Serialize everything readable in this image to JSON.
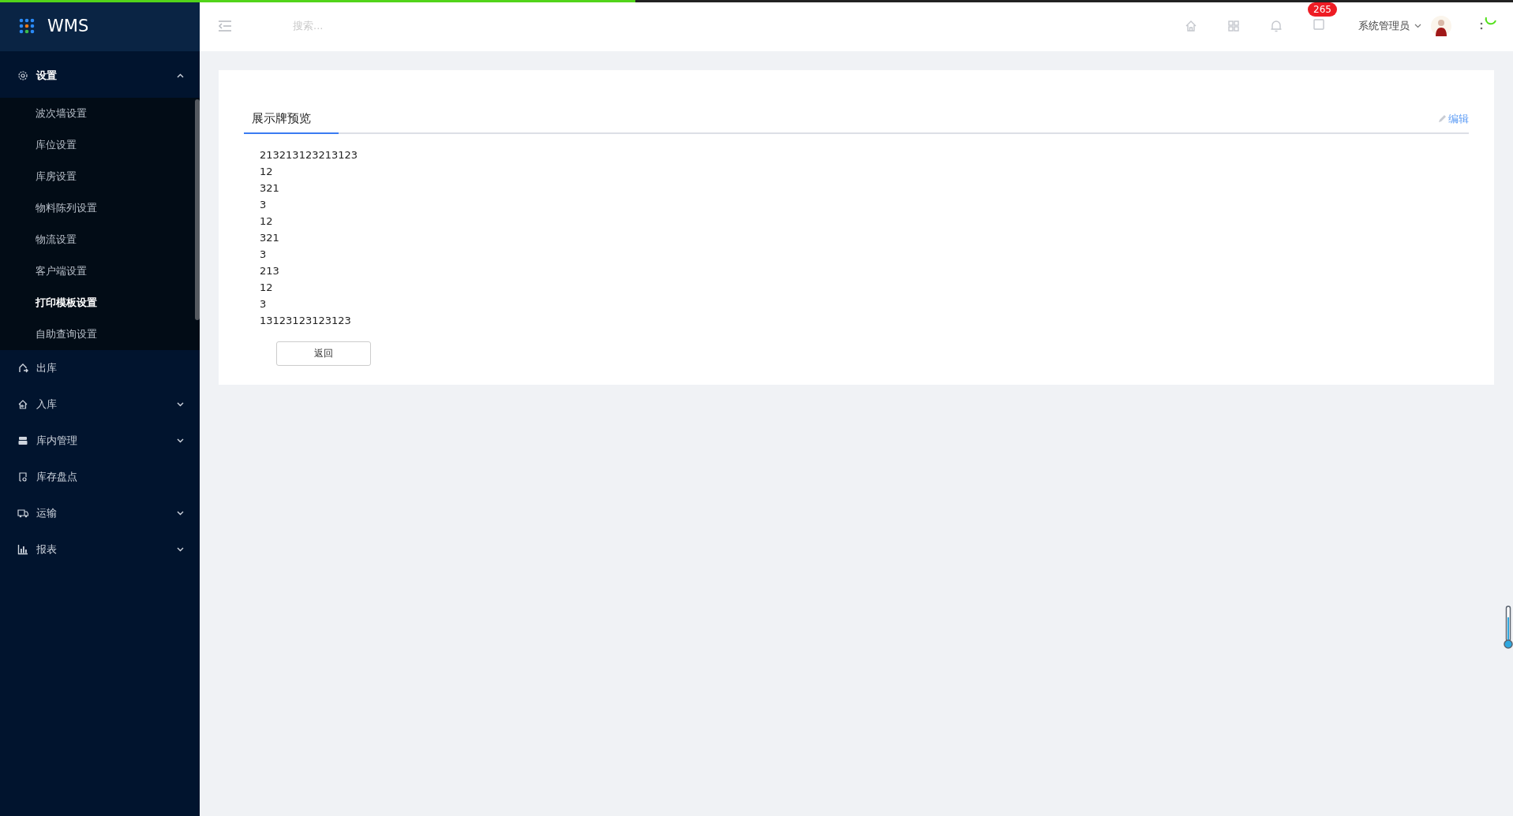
{
  "app": {
    "title": "WMS"
  },
  "progress": {
    "level": 0.42
  },
  "sidebar": {
    "items": [
      {
        "label": "设置",
        "expanded": true,
        "children": [
          {
            "label": "波次墙设置",
            "selected": false
          },
          {
            "label": "库位设置",
            "selected": false
          },
          {
            "label": "库房设置",
            "selected": false
          },
          {
            "label": "物料陈列设置",
            "selected": false
          },
          {
            "label": "物流设置",
            "selected": false
          },
          {
            "label": "客户端设置",
            "selected": false
          },
          {
            "label": "打印模板设置",
            "selected": true
          },
          {
            "label": "自助查询设置",
            "selected": false
          }
        ]
      },
      {
        "label": "出库"
      },
      {
        "label": "入库",
        "expanded": false
      },
      {
        "label": "库内管理",
        "expanded": false
      },
      {
        "label": "库存盘点"
      },
      {
        "label": "运输",
        "expanded": false
      },
      {
        "label": "报表",
        "expanded": false
      }
    ]
  },
  "header": {
    "search": {
      "placeholder": "搜索..."
    },
    "message_badge": "265",
    "user": "系统管理员"
  },
  "panel": {
    "tab": {
      "label": "展示牌预览",
      "selected": true
    },
    "edit_link": "编辑",
    "lines": [
      "213213123213123",
      "12",
      "321",
      "3",
      "12",
      "321",
      "3",
      "213",
      "12",
      "3",
      "13123123123123"
    ],
    "back_button": "返回"
  }
}
